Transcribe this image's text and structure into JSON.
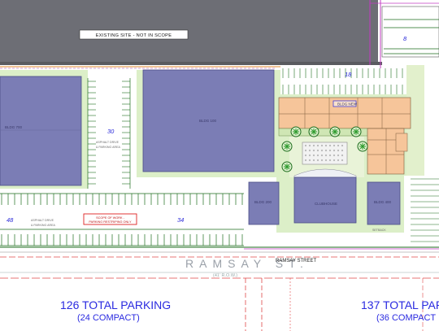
{
  "labels": {
    "existing_site": "EXISTING SITE - NOT IN SCOPE",
    "scope_of_work": "SCOPE OF WORK -",
    "parking_restriping": "PARKING RESTRIPING ONLY",
    "street_outline": "RAMSAY ST.",
    "street_label": "RAMSAY STREET",
    "row": "(41' R.O.W.)",
    "asphalt": "ASPHALT DRIVE",
    "parking_area": "& PARKING AREA",
    "setback": "SETBACK"
  },
  "buildings": {
    "b700": "BLDG 700",
    "b100": "BLDG 100",
    "b200": "BLDG 200",
    "b400": "BLDG 400",
    "clubhouse": "CLUBHOUSE",
    "bnew": "BLDG NEW"
  },
  "stall_counts": {
    "c8": "8",
    "c18": "18",
    "c30": "30",
    "c48": "48",
    "c34": "34"
  },
  "parking": {
    "left_total": "126 TOTAL PARKING",
    "left_compact": "(24 COMPACT)",
    "right_total": "137 TOTAL PAR",
    "right_compact": "(36 COMPACT"
  },
  "colors": {
    "building": "#7b7db5",
    "roof_dark": "#6d6e75",
    "retail": "#f6c59a",
    "grass": "#d9efc5",
    "tree": "#2e9b2e",
    "parking_line": "#1e6e1e",
    "scope_red": "#d22",
    "blue_text": "#2a2ae0",
    "magenta": "#c23bc2"
  }
}
